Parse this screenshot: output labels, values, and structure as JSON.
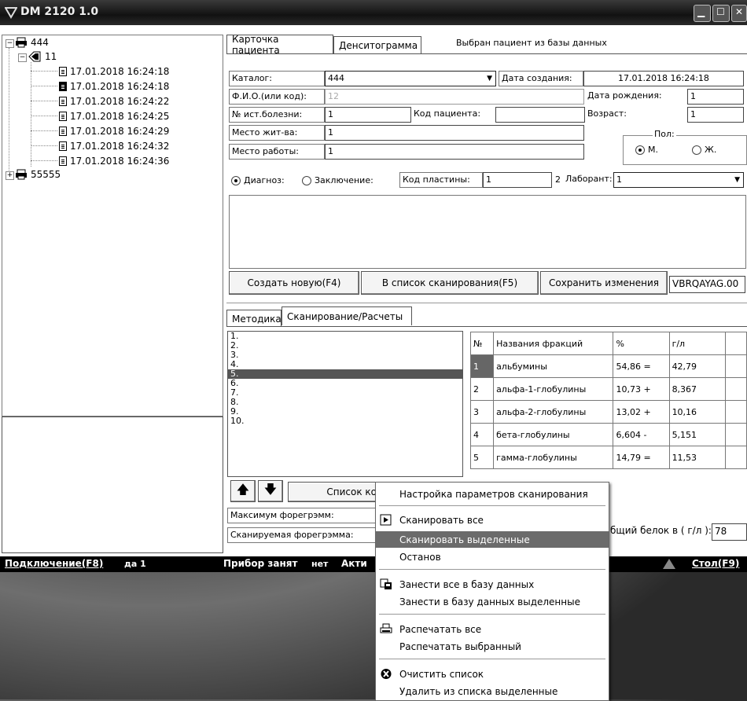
{
  "window": {
    "title": "DM 2120 1.0"
  },
  "tree": {
    "root1": "444",
    "child": "11",
    "records": [
      "17.01.2018 16:24:18",
      "17.01.2018 16:24:18",
      "17.01.2018 16:24:22",
      "17.01.2018 16:24:25",
      "17.01.2018 16:24:29",
      "17.01.2018 16:24:32",
      "17.01.2018 16:24:36"
    ],
    "root2": "55555",
    "expanders": {
      "root1": "−",
      "child": "−",
      "root2": "+"
    }
  },
  "top_tabs": {
    "card": "Карточка пациента",
    "densito": "Денситограмма",
    "status": "Выбран пациент из базы данных"
  },
  "form": {
    "catalog_label": "Каталог:",
    "catalog_value": "444",
    "created_label": "Дата создания:",
    "created_value": "17.01.2018 16:24:18",
    "fio_label": "Ф.И.О.(или код):",
    "fio_value": "12",
    "birth_label": "Дата рождения:",
    "birth_value": "1",
    "history_label": "№ ист.болезни:",
    "history_value": "1",
    "patient_code_label": "Код пациента:",
    "patient_code_value": "",
    "age_label": "Возраст:",
    "age_value": "1",
    "residence_label": "Место жит-ва:",
    "residence_value": "1",
    "work_label": "Место работы:",
    "work_value": "1",
    "sex_label": "Пол:",
    "sex_m": "М.",
    "sex_f": "Ж.",
    "diag_label": "Диагноз:",
    "concl_label": "Заключение:",
    "plate_label": "Код пластины:",
    "plate_value": "1",
    "plate_num": "2",
    "lab_label": "Лаборант:",
    "lab_value": "1",
    "notes": ""
  },
  "buttons": {
    "create": "Создать новую(F4)",
    "to_scan": "В список сканирования(F5)",
    "save": "Сохранить изменения",
    "file_code": "VBRQAYAG.00",
    "scan_list": "Список ко"
  },
  "bottom_tabs": {
    "method": "Методика",
    "scan": "Сканирование/Расчеты"
  },
  "scan_list": [
    "1.",
    "2.",
    "3.",
    "4.",
    "5.",
    "6.",
    "7.",
    "8.",
    "9.",
    "10."
  ],
  "fractions": {
    "headers": [
      "№",
      "Названия фракций",
      "%",
      "г/л"
    ],
    "rows": [
      [
        "1",
        "альбумины",
        "54,86 =",
        "42,79"
      ],
      [
        "2",
        "альфа-1-глобулины",
        "10,73 +",
        "8,367"
      ],
      [
        "3",
        "альфа-2-глобулины",
        "13,02 +",
        "10,16"
      ],
      [
        "4",
        "бета-глобулины",
        "6,604 -",
        "5,151"
      ],
      [
        "5",
        "гамма-глобулины",
        "14,79 =",
        "11,53"
      ]
    ]
  },
  "bottom_fields": {
    "max_label": "Максимум форегрэмм:",
    "current_label": "Сканируемая форегрэмма:",
    "protein_label": "бщий белок в ( г/л ):",
    "protein_value": "78"
  },
  "status": {
    "connect": "Подключение(F8)",
    "connect_val": "да 1",
    "busy": "Прибор занят",
    "busy_val": "нет",
    "active": "Акти",
    "table": "Стол(F9)"
  },
  "menu": {
    "items": [
      "Настройка параметров сканирования",
      "Сканировать все",
      "Сканировать выделенные",
      "Останов",
      "Занести все в базу данных",
      "Занести в базу данных выделенные",
      "Распечатать все",
      "Распечатать выбранный",
      "Очистить список",
      "Удалить из списка выделенные"
    ]
  }
}
